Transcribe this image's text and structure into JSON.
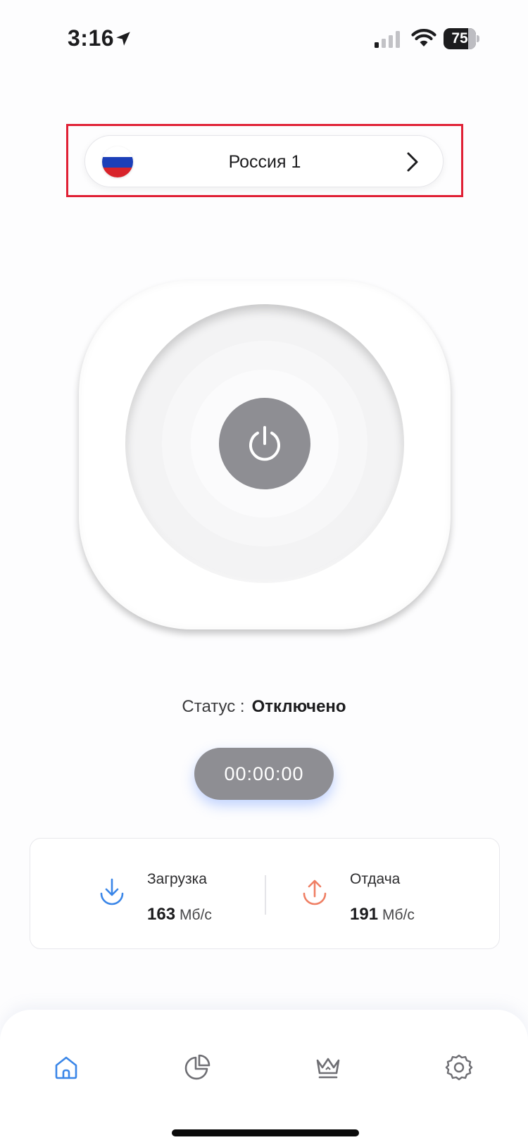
{
  "status_bar": {
    "time": "3:16",
    "battery_level": "75",
    "battery_fraction": 0.75,
    "icons": [
      "location-arrow-icon",
      "cellular-signal-icon",
      "wifi-icon",
      "battery-icon"
    ]
  },
  "server": {
    "name": "Россия 1",
    "flag": "russia-flag-icon",
    "flag_colors": [
      "#ffffff",
      "#1c3fb8",
      "#d8232a"
    ]
  },
  "power": {
    "icon": "power-icon"
  },
  "status": {
    "label": "Статус :",
    "value": "Отключено"
  },
  "timer": {
    "value": "00:00:00"
  },
  "speed": {
    "download": {
      "label": "Загрузка",
      "value": "163",
      "unit": "Мб/с",
      "icon": "download-arrow-icon",
      "color": "#3a86e8"
    },
    "upload": {
      "label": "Отдача",
      "value": "191",
      "unit": "Мб/с",
      "icon": "upload-arrow-icon",
      "color": "#ef7f64"
    }
  },
  "nav": {
    "items": [
      {
        "id": "home",
        "icon": "home-icon",
        "active": true
      },
      {
        "id": "stats",
        "icon": "pie-chart-icon",
        "active": false
      },
      {
        "id": "premium",
        "icon": "crown-icon",
        "active": false
      },
      {
        "id": "settings",
        "icon": "gear-icon",
        "active": false
      }
    ],
    "active_color": "#3a86e8",
    "inactive_color": "#6e6e73"
  },
  "colors": {
    "accent": "#3a86e8",
    "highlight": "#e02035",
    "power_button": "#8e8e93"
  }
}
